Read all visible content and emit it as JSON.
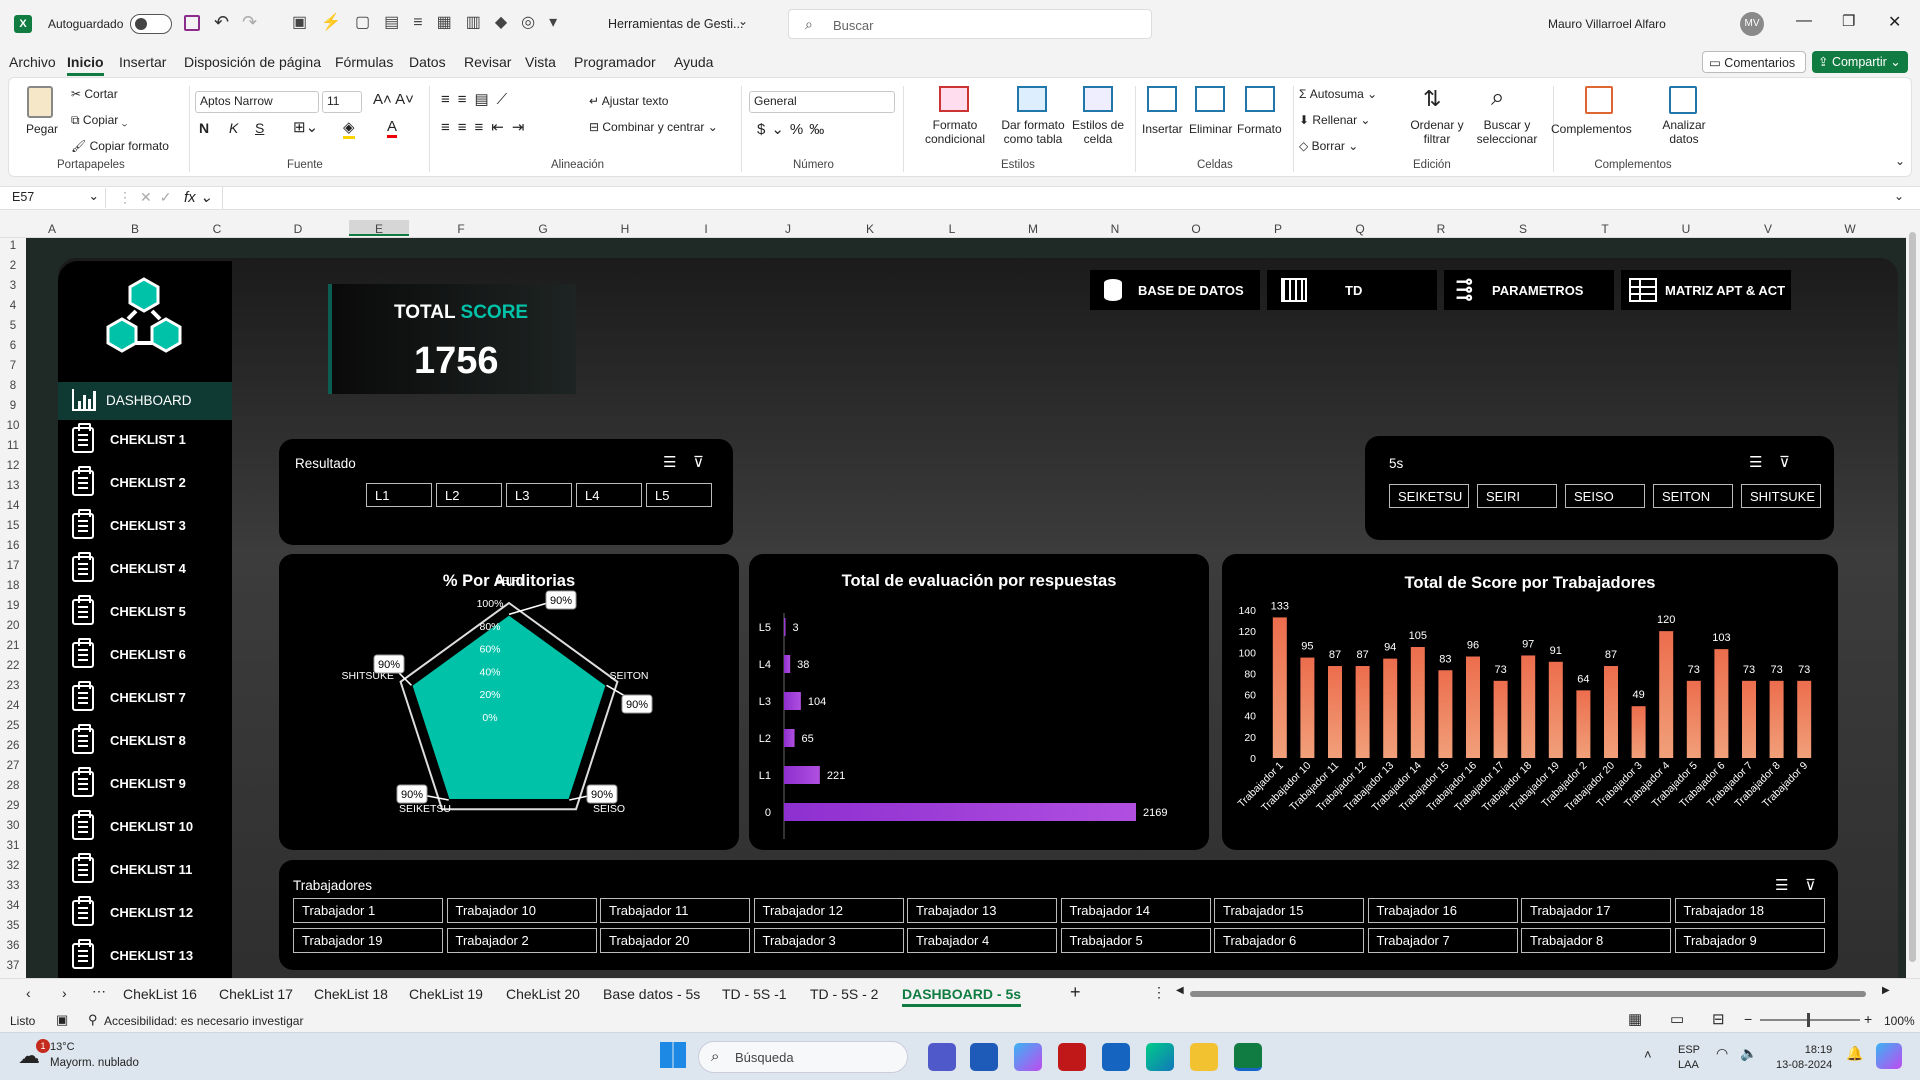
{
  "titlebar": {
    "autosave": "Autoguardado",
    "filename": "Herramientas de Gesti...",
    "search_placeholder": "Buscar",
    "user": "Mauro Villarroel Alfaro",
    "initials": "MV"
  },
  "menu": [
    "Archivo",
    "Inicio",
    "Insertar",
    "Disposición de página",
    "Fórmulas",
    "Datos",
    "Revisar",
    "Vista",
    "Programador",
    "Ayuda"
  ],
  "menu_right": {
    "comments": "Comentarios",
    "share": "Compartir"
  },
  "ribbon": {
    "clipboard": {
      "paste": "Pegar",
      "cut": "Cortar",
      "copy": "Copiar",
      "format_painter": "Copiar formato",
      "group": "Portapapeles"
    },
    "font": {
      "name": "Aptos Narrow",
      "size": "11",
      "bold": "N",
      "italic": "K",
      "underline": "S",
      "group": "Fuente"
    },
    "alignment": {
      "wrap": "Ajustar texto",
      "merge": "Combinar y centrar",
      "group": "Alineación"
    },
    "number": {
      "format": "General",
      "group": "Número"
    },
    "styles": {
      "conditional": "Formato condicional",
      "table": "Dar formato como tabla",
      "cell": "Estilos de celda",
      "group": "Estilos"
    },
    "cells": {
      "insert": "Insertar",
      "delete": "Eliminar",
      "format": "Formato",
      "group": "Celdas"
    },
    "editing": {
      "autosum": "Autosuma",
      "fill": "Rellenar",
      "clear": "Borrar",
      "sort": "Ordenar y filtrar",
      "find": "Buscar y seleccionar",
      "group": "Edición"
    },
    "addins": {
      "addins": "Complementos",
      "analyze": "Analizar datos",
      "group": "Complementos"
    }
  },
  "namebox": "E57",
  "columns": [
    "A",
    "B",
    "C",
    "D",
    "E",
    "F",
    "G",
    "H",
    "I",
    "J",
    "K",
    "L",
    "M",
    "N",
    "O",
    "P",
    "Q",
    "R",
    "S",
    "T",
    "U",
    "V",
    "W"
  ],
  "rows": [
    "1",
    "2",
    "3",
    "4",
    "5",
    "6",
    "7",
    "8",
    "9",
    "10",
    "11",
    "12",
    "13",
    "14",
    "15",
    "16",
    "17",
    "18",
    "19",
    "20",
    "21",
    "22",
    "23",
    "24",
    "25",
    "26",
    "27",
    "28",
    "29",
    "30",
    "31",
    "32",
    "33",
    "34",
    "35",
    "36",
    "37"
  ],
  "dashboard": {
    "sidebar": {
      "active": "DASHBOARD",
      "items": [
        "CHEKLIST 1",
        "CHEKLIST 2",
        "CHEKLIST 3",
        "CHEKLIST 4",
        "CHEKLIST 5",
        "CHEKLIST 6",
        "CHEKLIST 7",
        "CHEKLIST 8",
        "CHEKLIST 9",
        "CHEKLIST 10",
        "CHEKLIST 11",
        "CHEKLIST 12",
        "CHEKLIST 13"
      ]
    },
    "score": {
      "label1": "TOTAL",
      "label2": "SCORE",
      "value": "1756"
    },
    "nav_buttons": [
      "BASE DE DATOS",
      "TD",
      "PARAMETROS",
      "MATRIZ APT & ACT"
    ],
    "slicer_resultado": {
      "title": "Resultado",
      "items": [
        "L1",
        "L2",
        "L3",
        "L4",
        "L5"
      ]
    },
    "slicer_5s": {
      "title": "5s",
      "items": [
        "SEIKETSU",
        "SEIRI",
        "SEISO",
        "SEITON",
        "SHITSUKE"
      ]
    },
    "slicer_trab": {
      "title": "Trabajadores",
      "items": [
        "Trabajador 1",
        "Trabajador 10",
        "Trabajador 11",
        "Trabajador 12",
        "Trabajador 13",
        "Trabajador 14",
        "Trabajador 15",
        "Trabajador 16",
        "Trabajador 17",
        "Trabajador 18",
        "Trabajador 19",
        "Trabajador 2",
        "Trabajador 20",
        "Trabajador 3",
        "Trabajador 4",
        "Trabajador 5",
        "Trabajador 6",
        "Trabajador 7",
        "Trabajador 8",
        "Trabajador 9"
      ]
    },
    "colors": {
      "teal": "#00c2a8",
      "purple": "#9b3fd1",
      "orange": "#e8734a"
    }
  },
  "chart_data": [
    {
      "type": "radar",
      "title": "% Por Auditorias",
      "categories": [
        "SEIRI",
        "SEITON",
        "SEISO",
        "SEIKETSU",
        "SHITSUKE"
      ],
      "values": [
        90,
        90,
        90,
        90,
        90
      ],
      "data_labels": [
        "90%",
        "90%",
        "90%",
        "90%",
        "90%"
      ],
      "radial_ticks": [
        "0%",
        "20%",
        "40%",
        "60%",
        "80%",
        "100%"
      ],
      "rlim": [
        0,
        100
      ]
    },
    {
      "type": "bar",
      "orientation": "horizontal",
      "title": "Total de evaluación por respuestas",
      "categories": [
        "L5",
        "L4",
        "L3",
        "L2",
        "L1",
        "0"
      ],
      "values": [
        3,
        38,
        104,
        65,
        221,
        2169
      ]
    },
    {
      "type": "bar",
      "title": "Total de Score por Trabajadores",
      "categories": [
        "Trabajador 1",
        "Trabajador 10",
        "Trabajador 11",
        "Trabajador 12",
        "Trabajador 13",
        "Trabajador 14",
        "Trabajador 15",
        "Trabajador 16",
        "Trabajador 17",
        "Trabajador 18",
        "Trabajador 19",
        "Trabajador 2",
        "Trabajador 20",
        "Trabajador 3",
        "Trabajador 4",
        "Trabajador 5",
        "Trabajador 6",
        "Trabajador 7",
        "Trabajador 8",
        "Trabajador 9"
      ],
      "values": [
        133,
        95,
        87,
        87,
        94,
        105,
        83,
        96,
        73,
        97,
        91,
        64,
        87,
        49,
        120,
        73,
        103,
        73,
        73,
        73
      ],
      "yticks": [
        "0",
        "20",
        "40",
        "60",
        "80",
        "100",
        "120",
        "140"
      ],
      "ylim": [
        0,
        140
      ]
    }
  ],
  "sheets": [
    "ChekList 16",
    "ChekList 17",
    "ChekList 18",
    "ChekList 19",
    "ChekList 20",
    "Base datos - 5s",
    "TD - 5S -1",
    "TD - 5S - 2",
    "DASHBOARD - 5s"
  ],
  "status": {
    "ready": "Listo",
    "accessibility": "Accesibilidad: es necesario investigar",
    "zoom": "100%"
  },
  "taskbar": {
    "temp": "13°C",
    "weather": "Mayorm. nublado",
    "search": "Búsqueda",
    "lang1": "ESP",
    "lang2": "LAA",
    "time": "18:19",
    "date": "13-08-2024",
    "badge": "1"
  }
}
